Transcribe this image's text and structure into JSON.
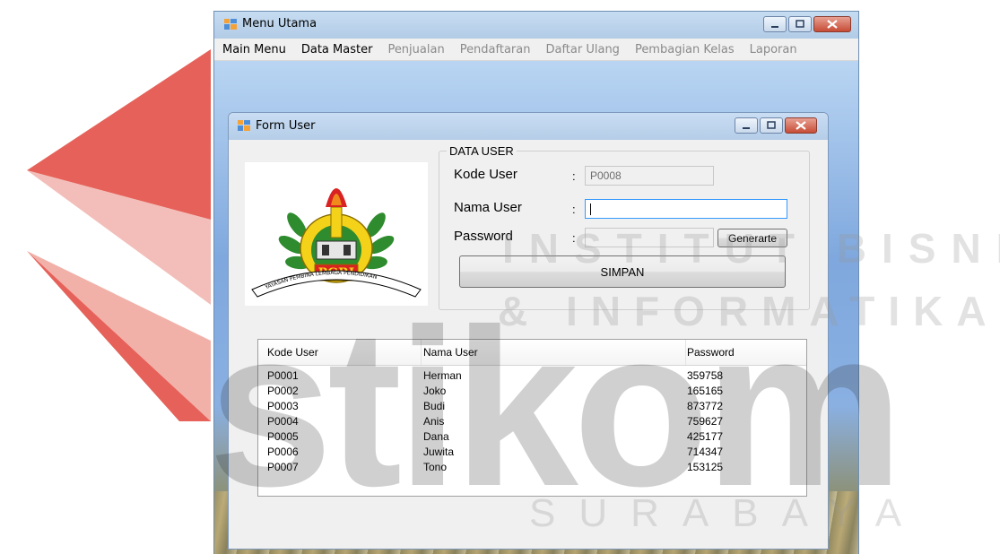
{
  "main_window": {
    "title": "Menu Utama",
    "menu": [
      {
        "label": "Main Menu",
        "enabled": true
      },
      {
        "label": "Data Master",
        "enabled": true
      },
      {
        "label": "Penjualan",
        "enabled": false
      },
      {
        "label": "Pendaftaran",
        "enabled": false
      },
      {
        "label": "Daftar Ulang",
        "enabled": false
      },
      {
        "label": "Pembagian Kelas",
        "enabled": false
      },
      {
        "label": "Laporan",
        "enabled": false
      }
    ]
  },
  "form": {
    "title": "Form User",
    "logo": {
      "text": "PGRI",
      "motto": "YAYASAN PEMBINA LEMBAGA PENDIDIKAN"
    },
    "group_title": "DATA USER",
    "fields": {
      "kode_user": {
        "label": "Kode User",
        "colon": ":",
        "value": "P0008"
      },
      "nama_user": {
        "label": "Nama User",
        "colon": ":",
        "value": ""
      },
      "password": {
        "label": "Password",
        "colon": ":",
        "value": ""
      }
    },
    "generate_button": "Generarte",
    "save_button": "SIMPAN",
    "table": {
      "columns": [
        "Kode User",
        "Nama User",
        "Password"
      ],
      "rows": [
        [
          "P0001",
          "Herman",
          "359758"
        ],
        [
          "P0002",
          "Joko",
          "165165"
        ],
        [
          "P0003",
          "Budi",
          "873772"
        ],
        [
          "P0004",
          "Anis",
          "759627"
        ],
        [
          "P0005",
          "Dana",
          "425177"
        ],
        [
          "P0006",
          "Juwita",
          "714347"
        ],
        [
          "P0007",
          "Tono",
          "153125"
        ]
      ]
    }
  },
  "watermark": {
    "line1": "INSTITUT BISNIS",
    "line2": "& INFORMATIKA",
    "line3": "SURABAYA",
    "brand": "stikom"
  }
}
